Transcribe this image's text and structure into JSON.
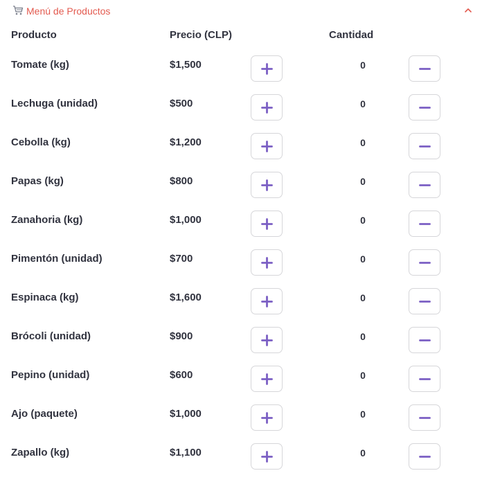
{
  "expander": {
    "title": "Menú de Productos",
    "icon": "cart-icon",
    "expanded": true
  },
  "columns": {
    "product": "Producto",
    "price": "Precio (CLP)",
    "quantity": "Cantidad"
  },
  "products": [
    {
      "name": "Tomate (kg)",
      "price": "$1,500",
      "qty": "0"
    },
    {
      "name": "Lechuga (unidad)",
      "price": "$500",
      "qty": "0"
    },
    {
      "name": "Cebolla (kg)",
      "price": "$1,200",
      "qty": "0"
    },
    {
      "name": "Papas (kg)",
      "price": "$800",
      "qty": "0"
    },
    {
      "name": "Zanahoria (kg)",
      "price": "$1,000",
      "qty": "0"
    },
    {
      "name": "Pimentón (unidad)",
      "price": "$700",
      "qty": "0"
    },
    {
      "name": "Espinaca (kg)",
      "price": "$1,600",
      "qty": "0"
    },
    {
      "name": "Brócoli (unidad)",
      "price": "$900",
      "qty": "0"
    },
    {
      "name": "Pepino (unidad)",
      "price": "$600",
      "qty": "0"
    },
    {
      "name": "Ajo (paquete)",
      "price": "$1,000",
      "qty": "0"
    },
    {
      "name": "Zapallo (kg)",
      "price": "$1,100",
      "qty": "0"
    }
  ],
  "colors": {
    "accent": "#7b5fc4",
    "title": "#e35a4f",
    "text": "#31333f",
    "border": "#d6d6d9"
  },
  "icons": {
    "add": "plus-icon",
    "remove": "minus-icon",
    "collapse": "chevron-up-icon"
  }
}
